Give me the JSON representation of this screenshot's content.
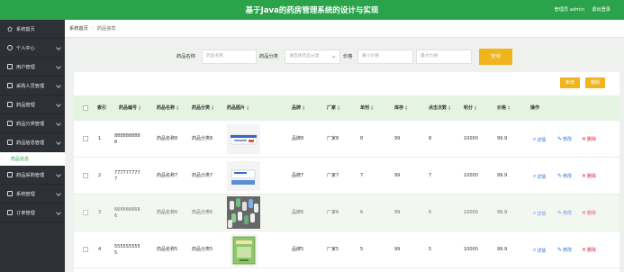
{
  "header": {
    "title": "基于Java的药房管理系统的设计与实现",
    "user": "管理员 admin",
    "logout": "退出登录"
  },
  "sidebar": {
    "items": [
      {
        "label": "系统首页",
        "icon": "home-icon"
      },
      {
        "label": "个人中心",
        "icon": "person-icon"
      },
      {
        "label": "用户管理",
        "icon": "user-icon"
      },
      {
        "label": "采购人员管理",
        "icon": "user-icon"
      },
      {
        "label": "药品管理",
        "icon": "list-icon"
      },
      {
        "label": "药品分类管理",
        "icon": "list-icon"
      },
      {
        "label": "药品信息管理",
        "icon": "list-icon"
      },
      {
        "label": "药品采购管理",
        "icon": "cart-icon"
      },
      {
        "label": "系统管理",
        "icon": "gear-icon"
      },
      {
        "label": "订单管理",
        "icon": "order-icon"
      }
    ],
    "sub_item": "药品信息"
  },
  "breadcrumb": {
    "home": "系统首页",
    "current": "药品信息"
  },
  "search": {
    "name_label": "药品名称",
    "name_placeholder": "药品名称",
    "category_label": "药品分类",
    "category_placeholder": "请选择药品分类",
    "price_label": "价格",
    "min_placeholder": "最小价格",
    "max_placeholder": "最大价格",
    "search_btn": "查询"
  },
  "actions": {
    "add": "新增",
    "delete": "删除"
  },
  "table": {
    "headers": [
      "索引",
      "药品编号",
      "药品名称",
      "药品分类",
      "药品图片",
      "品牌",
      "厂家",
      "单剂",
      "库存",
      "点击次数",
      "积分",
      "价格",
      "操作"
    ],
    "rows": [
      {
        "index": "1",
        "code": "8888888888",
        "name": "药品名称8",
        "category": "药品分类8",
        "brand": "品牌8",
        "factory": "厂家8",
        "dose": "8",
        "stock": "99",
        "clicks": "8",
        "points": "10000",
        "price": "99.9"
      },
      {
        "index": "2",
        "code": "7777777777",
        "name": "药品名称7",
        "category": "药品分类7",
        "brand": "品牌7",
        "factory": "厂家7",
        "dose": "7",
        "stock": "99",
        "clicks": "7",
        "points": "10000",
        "price": "99.9"
      },
      {
        "index": "3",
        "code": "6666666666",
        "name": "药品名称6",
        "category": "药品分类6",
        "brand": "品牌6",
        "factory": "厂家6",
        "dose": "6",
        "stock": "99",
        "clicks": "6",
        "points": "10000",
        "price": "99.9"
      },
      {
        "index": "4",
        "code": "5555555555",
        "name": "药品名称5",
        "category": "药品分类5",
        "brand": "品牌5",
        "factory": "厂家5",
        "dose": "5",
        "stock": "99",
        "clicks": "5",
        "points": "10000",
        "price": "99.9"
      }
    ],
    "ops": {
      "view": "详情",
      "edit": "修改",
      "del": "删除"
    }
  },
  "colors": {
    "primary": "#2aa34a",
    "accent": "#f0b41c",
    "sidebar": "#2d3035"
  }
}
